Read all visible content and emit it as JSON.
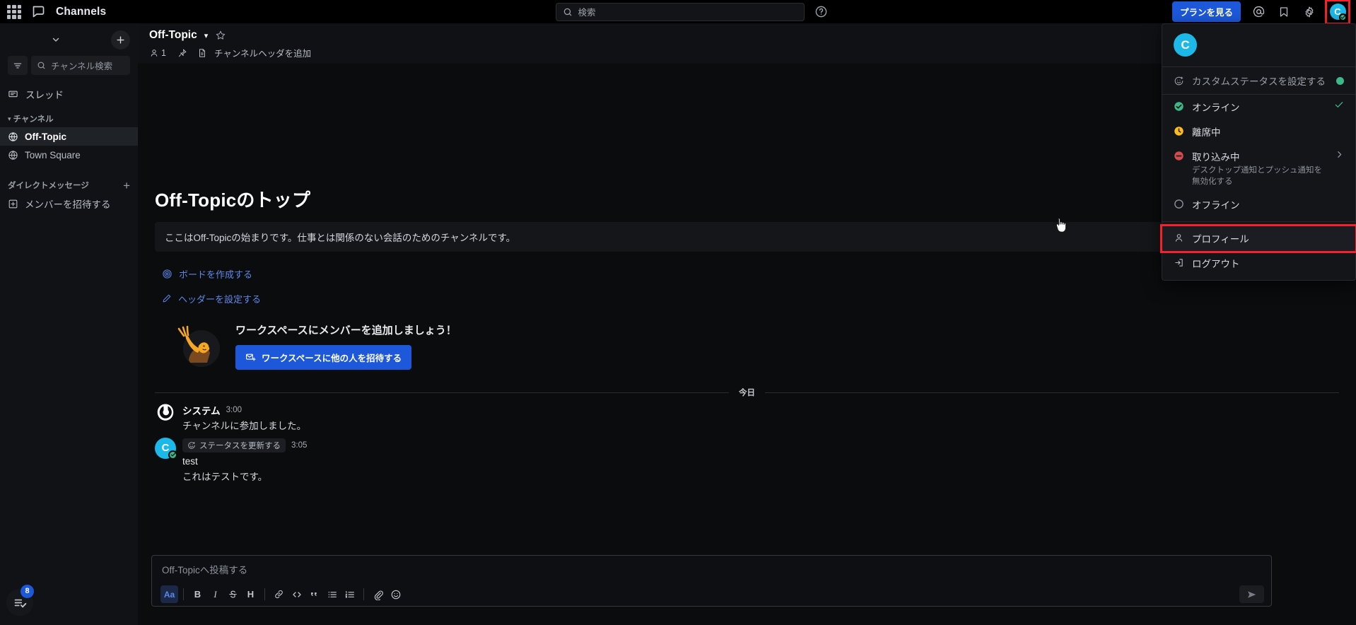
{
  "global_header": {
    "product_name": "Channels",
    "grid_icon": "grid-menu-icon",
    "product_icon": "channels-icon",
    "search": {
      "placeholder": "検索",
      "icon": "search-icon"
    },
    "help_icon": "help-circle-icon",
    "plan_button": "プランを見る",
    "mention_icon": "at-mention-icon",
    "saved_icon": "bookmark-flag-icon",
    "settings_icon": "gear-icon",
    "avatar_initial": "C",
    "avatar_status": "online",
    "accent_color": "#1c58d9",
    "avatar_color": "#1cb8e8",
    "online_color": "#3db887",
    "highlight_color": "#f5222d"
  },
  "sidebar": {
    "chevron_icon": "chevron-down-icon",
    "add_icon": "plus-icon",
    "filter_icon": "filter-icon",
    "channel_search": {
      "placeholder": "チャンネル検索",
      "icon": "search-icon"
    },
    "threads": {
      "label": "スレッド",
      "icon": "threads-icon"
    },
    "category_channels": "チャンネル",
    "channels": [
      {
        "label": "Off-Topic",
        "icon": "globe-icon",
        "active": true
      },
      {
        "label": "Town Square",
        "icon": "globe-icon",
        "active": false
      }
    ],
    "category_dm": "ダイレクトメッセージ",
    "dm_add_icon": "plus-icon",
    "invite_members": {
      "label": "メンバーを招待する",
      "icon": "add-member-icon"
    },
    "bottom_button": {
      "icon": "checklist-icon",
      "badge": "8"
    }
  },
  "channel_header": {
    "title": "Off-Topic",
    "caret_icon": "chevron-down-icon",
    "favorite_icon": "star-outline-icon",
    "member_icon": "person-icon",
    "member_count": "1",
    "pin_icon": "pin-icon",
    "file_icon": "file-text-icon",
    "add_header_link": "チャンネルヘッダを追加"
  },
  "intro": {
    "title": "Off-Topicのトップ",
    "description": "ここはOff-Topicの始まりです。仕事とは関係のない会話のためのチャンネルです。",
    "links": [
      {
        "label": "ボードを作成する",
        "icon": "board-icon"
      },
      {
        "label": "ヘッダーを設定する",
        "icon": "pencil-icon"
      }
    ],
    "invite_card": {
      "illustration": "waving-person-illustration",
      "title": "ワークスペースにメンバーを追加しましょう！",
      "button_label": "ワークスペースに他の人を招待する",
      "button_icon": "mail-invite-icon"
    }
  },
  "messages": {
    "date_separator": "今日",
    "posts": [
      {
        "avatar_type": "mattermost-logo",
        "author": "システム",
        "time": "3:00",
        "text": "チャンネルに参加しました。",
        "status_chip": null
      },
      {
        "avatar_type": "initial",
        "avatar_initial": "C",
        "author": "test",
        "time": "3:05",
        "text": "これはテストです。",
        "status_chip": {
          "label": "ステータスを更新する",
          "icon": "emoji-status-icon"
        }
      }
    ]
  },
  "composer": {
    "placeholder": "Off-Topicへ投稿する",
    "toolbar": [
      {
        "name": "formatting-toggle",
        "label": "Aa",
        "icon": "text-format-icon",
        "active": true
      },
      {
        "name": "bold",
        "label": "B",
        "icon": "bold-icon"
      },
      {
        "name": "italic",
        "label": "I",
        "icon": "italic-icon"
      },
      {
        "name": "strikethrough",
        "label": "S",
        "icon": "strikethrough-icon"
      },
      {
        "name": "heading",
        "label": "H",
        "icon": "heading-icon"
      },
      {
        "name": "link",
        "label": "",
        "icon": "link-icon"
      },
      {
        "name": "code",
        "label": "",
        "icon": "code-icon"
      },
      {
        "name": "quote",
        "label": "",
        "icon": "quote-icon"
      },
      {
        "name": "bulleted-list",
        "label": "",
        "icon": "bulleted-list-icon"
      },
      {
        "name": "numbered-list",
        "label": "",
        "icon": "numbered-list-icon"
      },
      {
        "name": "attachment",
        "label": "",
        "icon": "paperclip-icon"
      },
      {
        "name": "emoji",
        "label": "",
        "icon": "emoji-smiley-icon"
      }
    ],
    "send_icon": "send-icon"
  },
  "status_menu": {
    "avatar_initial": "C",
    "custom_status": {
      "label": "カスタムステータスを設定する",
      "icon": "emoji-status-icon"
    },
    "items": [
      {
        "label": "オンライン",
        "icon": "status-online-icon",
        "checked": true,
        "sub": null,
        "chevron": false,
        "color": "#3db887"
      },
      {
        "label": "離席中",
        "icon": "status-away-icon",
        "checked": false,
        "sub": null,
        "chevron": false,
        "color": "#ffbc1f"
      },
      {
        "label": "取り込み中",
        "icon": "status-dnd-icon",
        "checked": false,
        "sub": "デスクトップ通知とプッシュ通知を無効化する",
        "chevron": true,
        "color": "#d24b4e"
      },
      {
        "label": "オフライン",
        "icon": "status-offline-icon",
        "checked": false,
        "sub": null,
        "chevron": false,
        "color": "#8d929b"
      }
    ],
    "actions": [
      {
        "label": "プロフィール",
        "icon": "person-outline-icon",
        "highlighted": true
      },
      {
        "label": "ログアウト",
        "icon": "logout-icon",
        "highlighted": false
      }
    ],
    "check_icon": "check-icon"
  }
}
